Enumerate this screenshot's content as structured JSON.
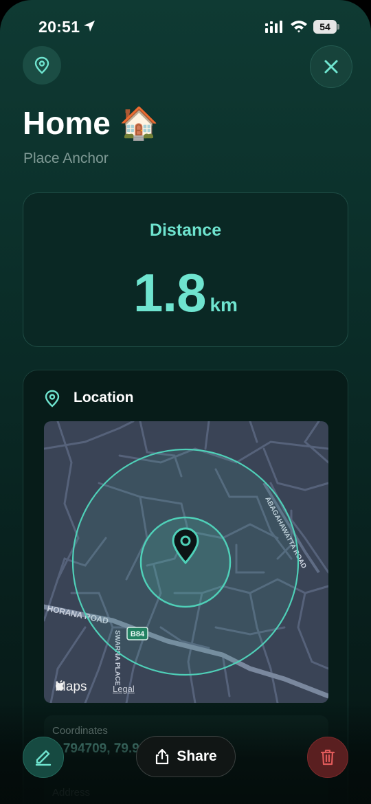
{
  "status_bar": {
    "time": "20:51",
    "battery": "54"
  },
  "header": {
    "title": "Home 🏠",
    "subtitle": "Place Anchor"
  },
  "distance": {
    "label": "Distance",
    "value": "1.8",
    "unit": "km"
  },
  "location": {
    "heading": "Location",
    "map": {
      "attribution": "Maps",
      "legal": "Legal",
      "roads": [
        "HORANA ROAD",
        "ABAGAHAWATTA ROAD",
        "SWARNA PLACE"
      ],
      "route_badge": "B84"
    },
    "coordinates_label": "Coordinates",
    "coordinates_value": "6.794709, 79.9",
    "address_label": "Address"
  },
  "actions": {
    "share_label": "Share"
  },
  "colors": {
    "accent": "#6fe4cf",
    "danger": "#e05a5a",
    "background": "#0b2e29"
  }
}
